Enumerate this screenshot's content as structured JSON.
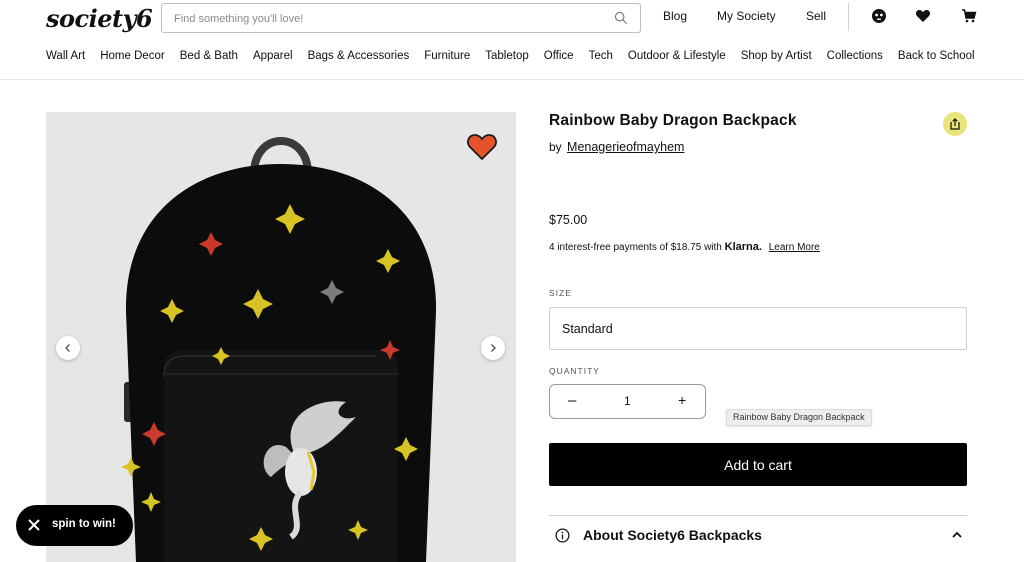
{
  "header": {
    "logo": "society6",
    "search_placeholder": "Find something you'll love!",
    "links": [
      "Blog",
      "My Society",
      "Sell"
    ]
  },
  "nav": [
    "Wall Art",
    "Home Decor",
    "Bed & Bath",
    "Apparel",
    "Bags & Accessories",
    "Furniture",
    "Tabletop",
    "Office",
    "Tech",
    "Outdoor & Lifestyle",
    "Shop by Artist",
    "Collections",
    "Back to School"
  ],
  "product": {
    "title": "Rainbow Baby Dragon Backpack",
    "by_label": "by",
    "artist": "Menagerieofmayhem",
    "price": "$75.00",
    "klarna_text": "4 interest-free payments of $18.75 with",
    "klarna_brand": "Klarna.",
    "learn_more": "Learn More",
    "size_label": "SIZE",
    "size_value": "Standard",
    "quantity_label": "QUANTITY",
    "quantity_value": "1",
    "minus": "–",
    "plus": "+",
    "tooltip": "Rainbow Baby Dragon Backpack",
    "add_to_cart": "Add to cart",
    "about": "About Society6 Backpacks"
  },
  "promo": {
    "label": "spin to win!"
  },
  "colors": {
    "favorite": "#e5532b",
    "share_bg": "#e8e47a",
    "button": "#000000"
  }
}
